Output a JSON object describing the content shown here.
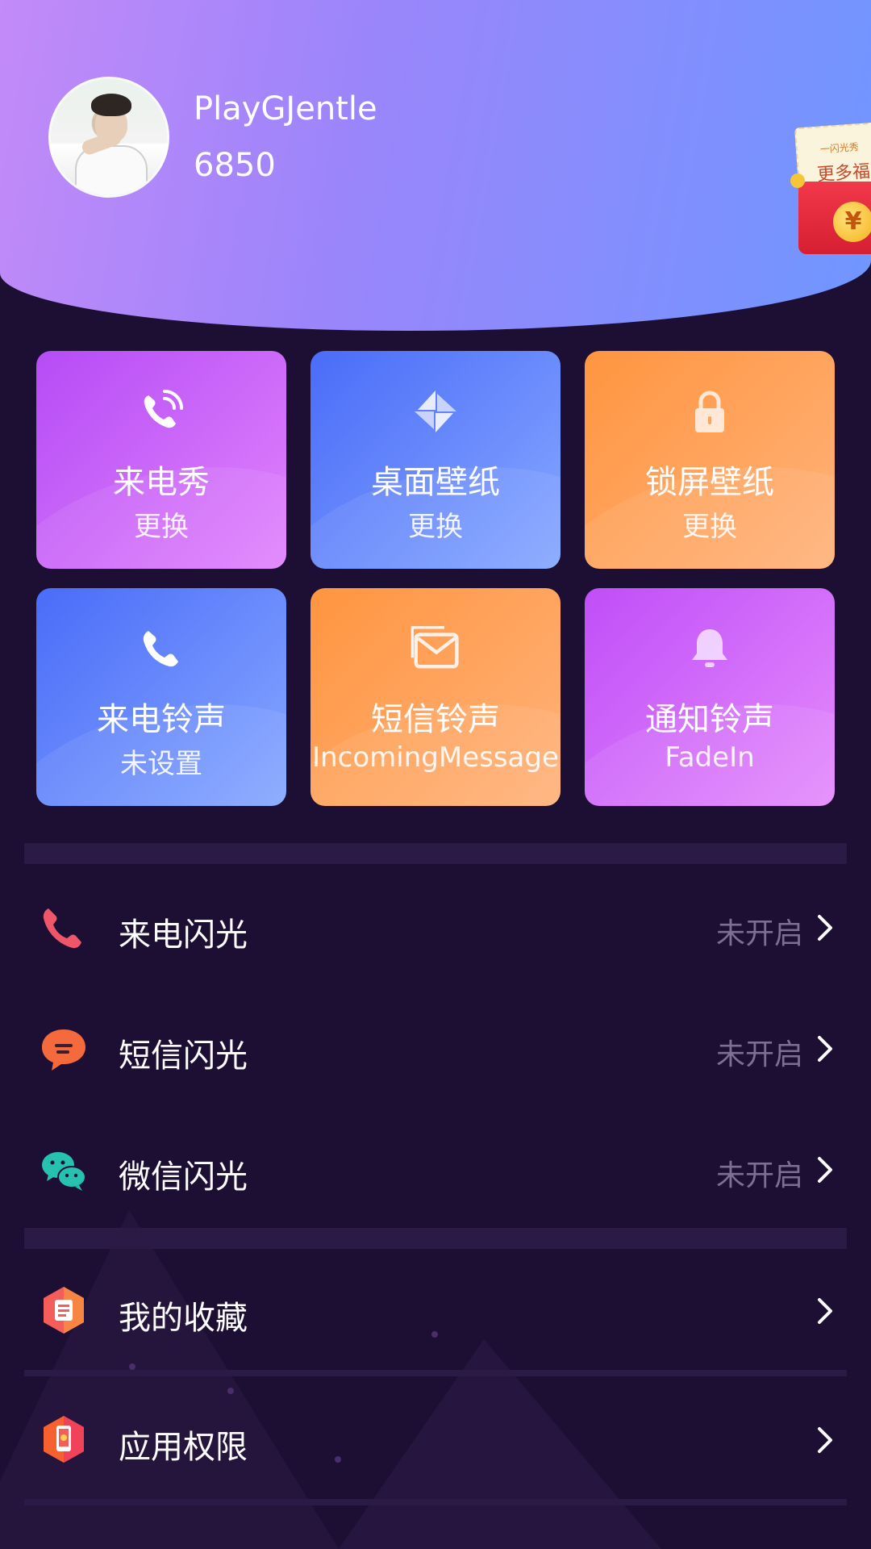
{
  "profile": {
    "name": "PlayGJentle",
    "score": "6850"
  },
  "promo": {
    "small_text": "一闪光秀",
    "big_text": "更多福",
    "coin_symbol": "¥"
  },
  "tiles": [
    {
      "title": "来电秀",
      "sub": "更换",
      "icon": "phone-ringing-icon"
    },
    {
      "title": "桌面壁纸",
      "sub": "更换",
      "icon": "pinwheel-icon"
    },
    {
      "title": "锁屏壁纸",
      "sub": "更换",
      "icon": "lock-icon"
    },
    {
      "title": "来电铃声",
      "sub": "未设置",
      "icon": "phone-icon"
    },
    {
      "title": "短信铃声",
      "sub": "IncomingMessage",
      "icon": "envelope-icon"
    },
    {
      "title": "通知铃声",
      "sub": "FadeIn",
      "icon": "bell-icon"
    }
  ],
  "flash_settings": [
    {
      "label": "来电闪光",
      "status": "未开启",
      "icon": "phone-icon"
    },
    {
      "label": "短信闪光",
      "status": "未开启",
      "icon": "chat-bubble-icon"
    },
    {
      "label": "微信闪光",
      "status": "未开启",
      "icon": "wechat-icon"
    }
  ],
  "menu": [
    {
      "label": "我的收藏",
      "icon": "favorites-icon"
    },
    {
      "label": "应用权限",
      "icon": "app-permission-icon"
    }
  ],
  "colors": {
    "background": "#1d0f33",
    "status_text": "#7e6e93",
    "header_gradient_start": "#c38af8",
    "header_gradient_end": "#6f96ff"
  }
}
